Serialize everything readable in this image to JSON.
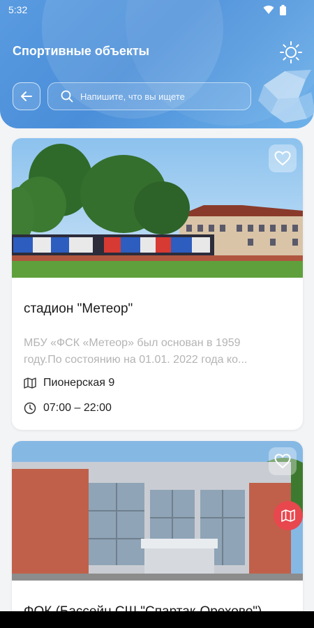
{
  "status_bar": {
    "time": "5:32",
    "wifi_icon": "wifi-icon",
    "battery_icon": "battery-icon"
  },
  "header": {
    "title": "Спортивные объекты",
    "theme_icon": "sun-icon",
    "back_icon": "arrow-left-icon",
    "search": {
      "placeholder": "Напишите, что вы ищете",
      "value": ""
    }
  },
  "cards": [
    {
      "title": "стадион \"Метеор\"",
      "description_lines": [
        "МБУ «ФСК «Метеор» был основан в 1959",
        "году.По состоянию на 01.01. 2022 года ко..."
      ],
      "address": "Пионерская 9",
      "hours": "07:00 – 22:00",
      "favorite_icon": "heart-icon"
    },
    {
      "title": "ФОК (Бассейн СШ \"Спартак-Орехово\")",
      "favorite_icon": "heart-icon",
      "map_icon": "map-icon"
    }
  ],
  "colors": {
    "header": "#4a8ed9",
    "map_button": "#e8474e",
    "muted_text": "#b4b4b4"
  }
}
